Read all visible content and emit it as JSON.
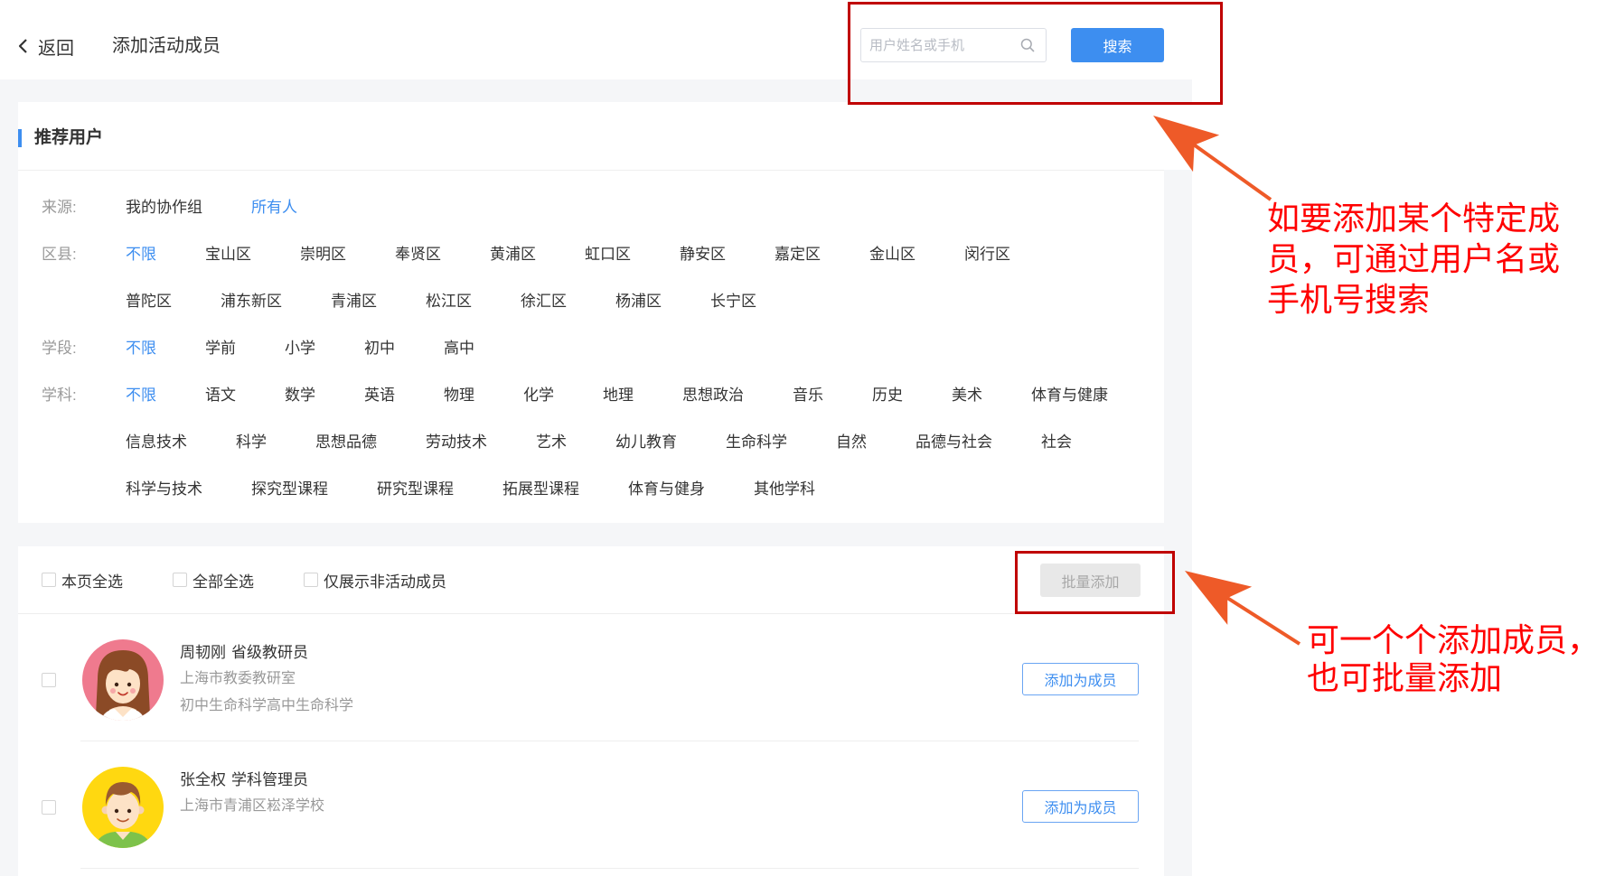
{
  "header": {
    "back_label": "返回",
    "title": "添加活动成员"
  },
  "search": {
    "placeholder": "用户姓名或手机",
    "button_label": "搜索"
  },
  "recommend": {
    "title": "推荐用户",
    "filters": [
      {
        "label": "来源:",
        "options": [
          "我的协作组",
          "所有人"
        ],
        "selected": "所有人"
      },
      {
        "label": "区县:",
        "options": [
          "不限",
          "宝山区",
          "崇明区",
          "奉贤区",
          "黄浦区",
          "虹口区",
          "静安区",
          "嘉定区",
          "金山区",
          "闵行区",
          "普陀区",
          "浦东新区",
          "青浦区",
          "松江区",
          "徐汇区",
          "杨浦区",
          "长宁区"
        ],
        "selected": "不限"
      },
      {
        "label": "学段:",
        "options": [
          "不限",
          "学前",
          "小学",
          "初中",
          "高中"
        ],
        "selected": "不限"
      },
      {
        "label": "学科:",
        "options": [
          "不限",
          "语文",
          "数学",
          "英语",
          "物理",
          "化学",
          "地理",
          "思想政治",
          "音乐",
          "历史",
          "美术",
          "体育与健康",
          "信息技术",
          "科学",
          "思想品德",
          "劳动技术",
          "艺术",
          "幼儿教育",
          "生命科学",
          "自然",
          "品德与社会",
          "社会",
          "科学与技术",
          "探究型课程",
          "研究型课程",
          "拓展型课程",
          "体育与健身",
          "其他学科"
        ],
        "selected": "不限"
      }
    ]
  },
  "toolbar": {
    "select_page_label": "本页全选",
    "select_all_label": "全部全选",
    "only_inactive_label": "仅展示非活动成员",
    "batch_add_label": "批量添加",
    "batch_add_enabled": false
  },
  "members": [
    {
      "name": "周韧刚",
      "role": "省级教研员",
      "org": "上海市教委教研室",
      "subjects": "初中生命科学高中生命科学",
      "add_label": "添加为成员"
    },
    {
      "name": "张全权",
      "role": "学科管理员",
      "org": "上海市青浦区崧泽学校",
      "add_label": "添加为成员"
    }
  ],
  "annotations": [
    {
      "lines": [
        "如要添加某个特定成",
        "员，可通过用户名或",
        "手机号搜索"
      ]
    },
    {
      "lines": [
        "可一个个添加成员，",
        "也可批量添加"
      ]
    }
  ],
  "colors": {
    "accent": "#3d8ef0",
    "annotation_text": "#ff0000",
    "highlight_box": "#c00000",
    "arrow": "#ee5a28"
  },
  "icons": {
    "back": "chevron-left-icon",
    "search": "search-icon",
    "avatar_1": "girl-avatar-icon",
    "avatar_2": "boy-avatar-icon",
    "annotation": "arrow-icon"
  }
}
